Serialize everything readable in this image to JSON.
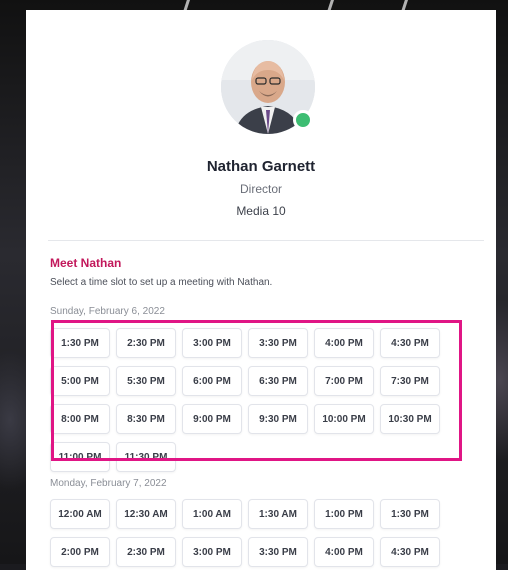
{
  "profile": {
    "name": "Nathan Garnett",
    "title": "Director",
    "company": "Media 10",
    "status_color": "#3dbd72"
  },
  "meeting": {
    "heading": "Meet Nathan",
    "description": "Select a time slot to set up a meeting with Nathan."
  },
  "days": [
    {
      "label": "Sunday, February 6, 2022",
      "slots": [
        "1:30 PM",
        "2:30 PM",
        "3:00 PM",
        "3:30 PM",
        "4:00 PM",
        "4:30 PM",
        "5:00 PM",
        "5:30 PM",
        "6:00 PM",
        "6:30 PM",
        "7:00 PM",
        "7:30 PM",
        "8:00 PM",
        "8:30 PM",
        "9:00 PM",
        "9:30 PM",
        "10:00 PM",
        "10:30 PM",
        "11:00 PM",
        "11:30 PM"
      ]
    },
    {
      "label": "Monday, February 7, 2022",
      "slots": [
        "12:00 AM",
        "12:30 AM",
        "1:00 AM",
        "1:30 AM",
        "1:00 PM",
        "1:30 PM",
        "2:00 PM",
        "2:30 PM",
        "3:00 PM",
        "3:30 PM",
        "4:00 PM",
        "4:30 PM"
      ]
    }
  ],
  "colors": {
    "accent": "#c2185b",
    "highlight_box": "#e01585"
  }
}
